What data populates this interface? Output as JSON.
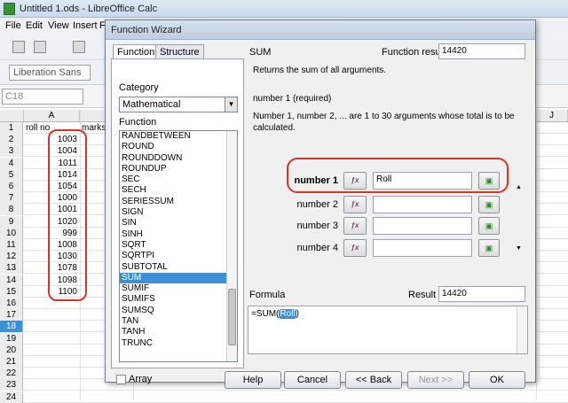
{
  "window": {
    "title": "Untitled 1.ods - LibreOffice Calc"
  },
  "menu": [
    "File",
    "Edit",
    "View",
    "Insert",
    "F"
  ],
  "fontbar": {
    "font_name": "Liberation Sans"
  },
  "namebox": {
    "value": "C18"
  },
  "sheet": {
    "columns": [
      "A",
      "",
      "",
      "",
      "",
      "",
      "",
      "",
      "J"
    ],
    "header_row": {
      "a": "roll no",
      "b": "marks"
    },
    "rows": [
      "1",
      "2",
      "3",
      "4",
      "5",
      "6",
      "7",
      "8",
      "9",
      "10",
      "11",
      "12",
      "13",
      "14",
      "15",
      "16",
      "17",
      "18",
      "19",
      "20",
      "21",
      "22",
      "23",
      "24"
    ],
    "values": [
      "1003",
      "1004",
      "1011",
      "1014",
      "1054",
      "1000",
      "1001",
      "1020",
      "999",
      "1008",
      "1030",
      "1078",
      "1098",
      "1100"
    ],
    "selected_row": "18"
  },
  "dialog": {
    "title": "Function Wizard",
    "tabs": [
      "Functions",
      "Structure"
    ],
    "category_label": "Category",
    "category_value": "Mathematical",
    "function_label": "Function",
    "functions": [
      "RANDBETWEEN",
      "ROUND",
      "ROUNDDOWN",
      "ROUNDUP",
      "SEC",
      "SECH",
      "SERIESSUM",
      "SIGN",
      "SIN",
      "SINH",
      "SQRT",
      "SQRTPI",
      "SUBTOTAL",
      "SUM",
      "SUMIF",
      "SUMIFS",
      "SUMSQ",
      "TAN",
      "TANH",
      "TRUNC"
    ],
    "selected_function": "SUM",
    "func_name": "SUM",
    "function_result_label": "Function result",
    "function_result_value": "14420",
    "description": "Returns the sum of all arguments.",
    "arg_required": "number 1 (required)",
    "arg_description": "Number 1, number 2, ... are 1 to 30 arguments whose total is to be calculated.",
    "args": [
      {
        "label": "number 1",
        "value": "Roll"
      },
      {
        "label": "number 2",
        "value": ""
      },
      {
        "label": "number 3",
        "value": ""
      },
      {
        "label": "number 4",
        "value": ""
      }
    ],
    "fx_icon": "fx-icon",
    "select_icon": "shrink-select-icon",
    "formula_label": "Formula",
    "result_label": "Result",
    "result_value": "14420",
    "formula_prefix": "=SUM(",
    "formula_highlight": "Roll",
    "formula_suffix": ")",
    "array_label": "Array",
    "buttons": {
      "help": "Help",
      "cancel": "Cancel",
      "back": "<< Back",
      "next": "Next >>",
      "ok": "OK"
    }
  }
}
